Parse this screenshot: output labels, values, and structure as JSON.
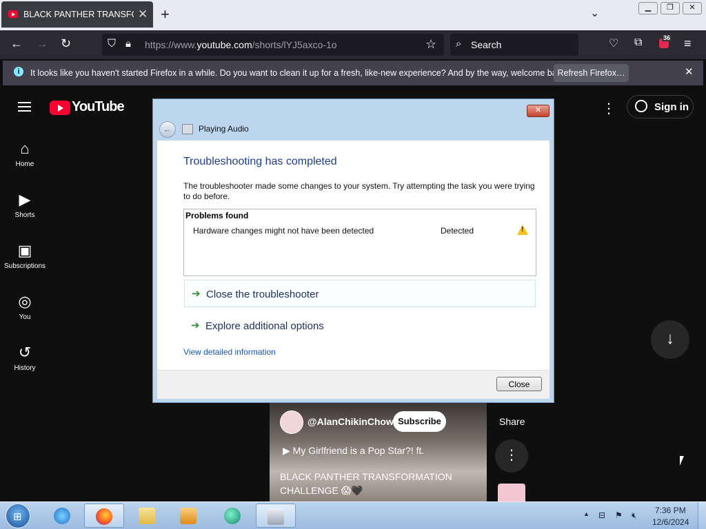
{
  "browser": {
    "tab_title": "BLACK PANTHER TRANSFORMATION CHALLENGE",
    "url_prefix": "https://www.",
    "url_domain": "youtube.com",
    "url_path": "/shorts/lYJ5axco-1o",
    "search_placeholder": "Search",
    "extension_badge": "36",
    "notification_text": "It looks like you haven't started Firefox in a while. Do you want to clean it up for a fresh, like-new experience? And by the way, welcome back!",
    "refresh_label": "Refresh Firefox…"
  },
  "youtube": {
    "logo_text": "YouTube",
    "nav": [
      {
        "label": "Home",
        "icon": "home-icon"
      },
      {
        "label": "Shorts",
        "icon": "shorts-icon"
      },
      {
        "label": "Subscriptions",
        "icon": "subscriptions-icon"
      },
      {
        "label": "You",
        "icon": "you-icon"
      },
      {
        "label": "History",
        "icon": "history-icon"
      }
    ],
    "sign_in": "Sign in",
    "channel": "@AlanChikinChow",
    "subscribe": "Subscribe",
    "song": "My Girlfriend is a Pop Star?! ft.",
    "video_title": "BLACK PANTHER TRANSFORMATION CHALLENGE 😱🖤",
    "share": "Share"
  },
  "dialog": {
    "title": "Playing Audio",
    "heading": "Troubleshooting has completed",
    "description": "The troubleshooter made some changes to your system. Try attempting the task you were trying to do before.",
    "problems_header": "Problems found",
    "problem_name": "Hardware changes might not have been detected",
    "problem_status": "Detected",
    "option_close": "Close the troubleshooter",
    "option_explore": "Explore additional options",
    "detail_link": "View detailed information",
    "close_button": "Close"
  },
  "taskbar": {
    "time": "7:36 PM",
    "date": "12/6/2024"
  },
  "colors": {
    "youtube_red": "#ff0033",
    "dialog_heading": "#1e3f8a",
    "link_blue": "#1a56b8"
  }
}
